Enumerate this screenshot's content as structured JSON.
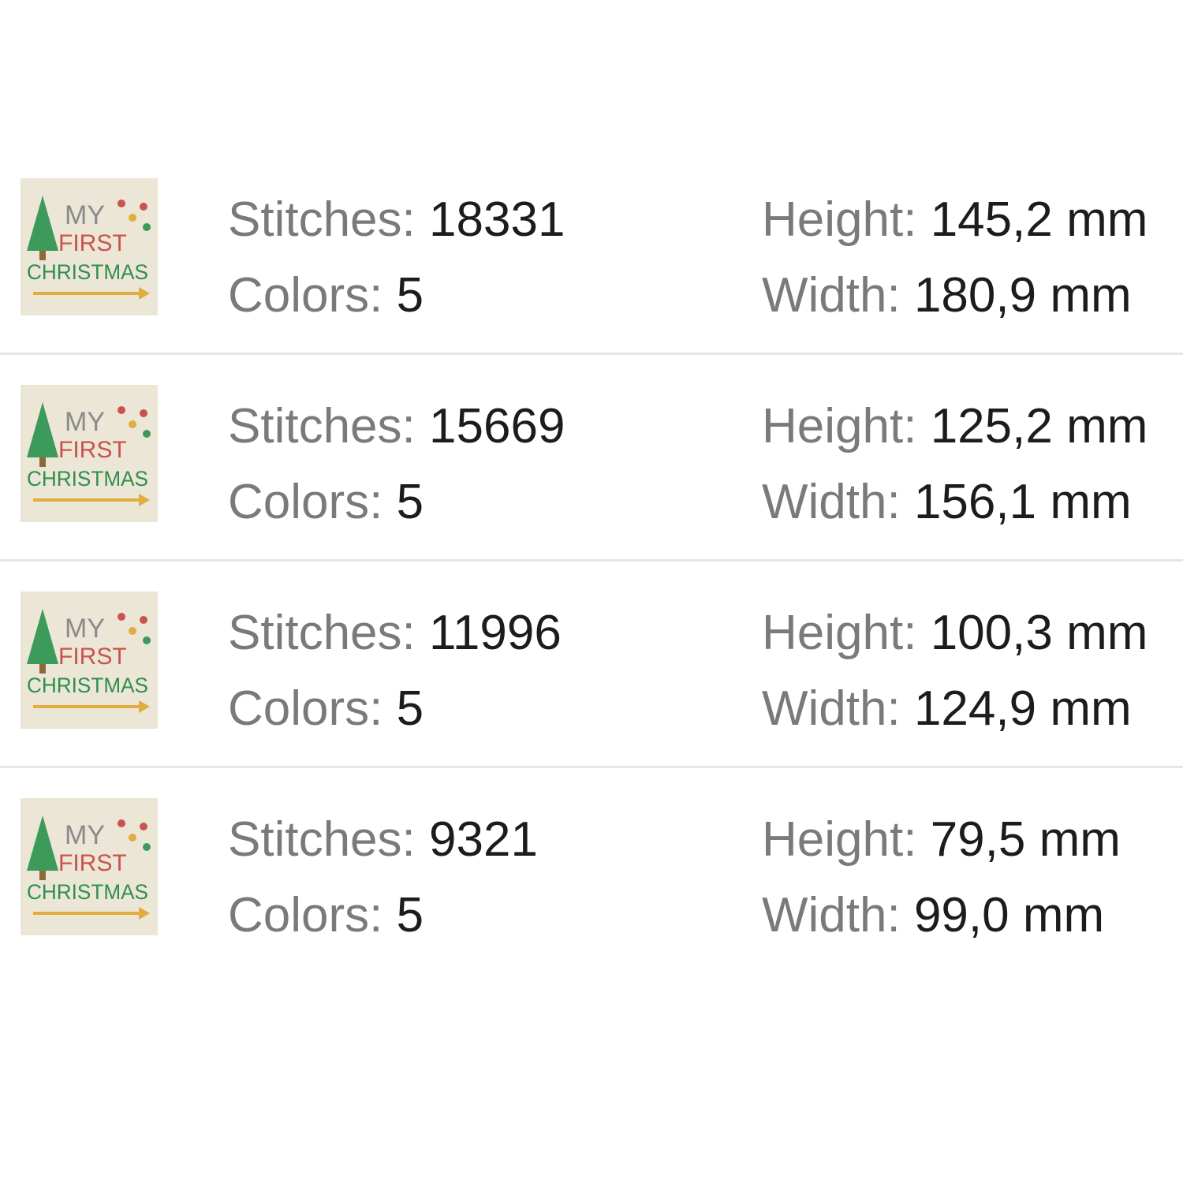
{
  "labels": {
    "stitches": "Stitches:",
    "colors": "Colors:",
    "height": "Height:",
    "width": "Width:"
  },
  "items": [
    {
      "stitches": "18331",
      "colors": "5",
      "height": "145,2 mm",
      "width": "180,9 mm"
    },
    {
      "stitches": "15669",
      "colors": "5",
      "height": "125,2 mm",
      "width": "156,1 mm"
    },
    {
      "stitches": "11996",
      "colors": "5",
      "height": "100,3 mm",
      "width": "124,9 mm"
    },
    {
      "stitches": "9321",
      "colors": "5",
      "height": "79,5 mm",
      "width": "99,0 mm"
    }
  ],
  "thumbnail": {
    "text_line1": "MY",
    "text_line2": "FIRST",
    "text_line3": "CHRISTMAS"
  },
  "colors": {
    "thumb_background": "#ebe6d6",
    "tree_green": "#3c9a5a",
    "christmas_green": "#2f8f4e",
    "first_red": "#c9534f",
    "arrow_gold": "#e1ad3e",
    "label_gray": "#7a7a7a",
    "value_black": "#1c1c1c",
    "separator": "#e6e6e6"
  }
}
